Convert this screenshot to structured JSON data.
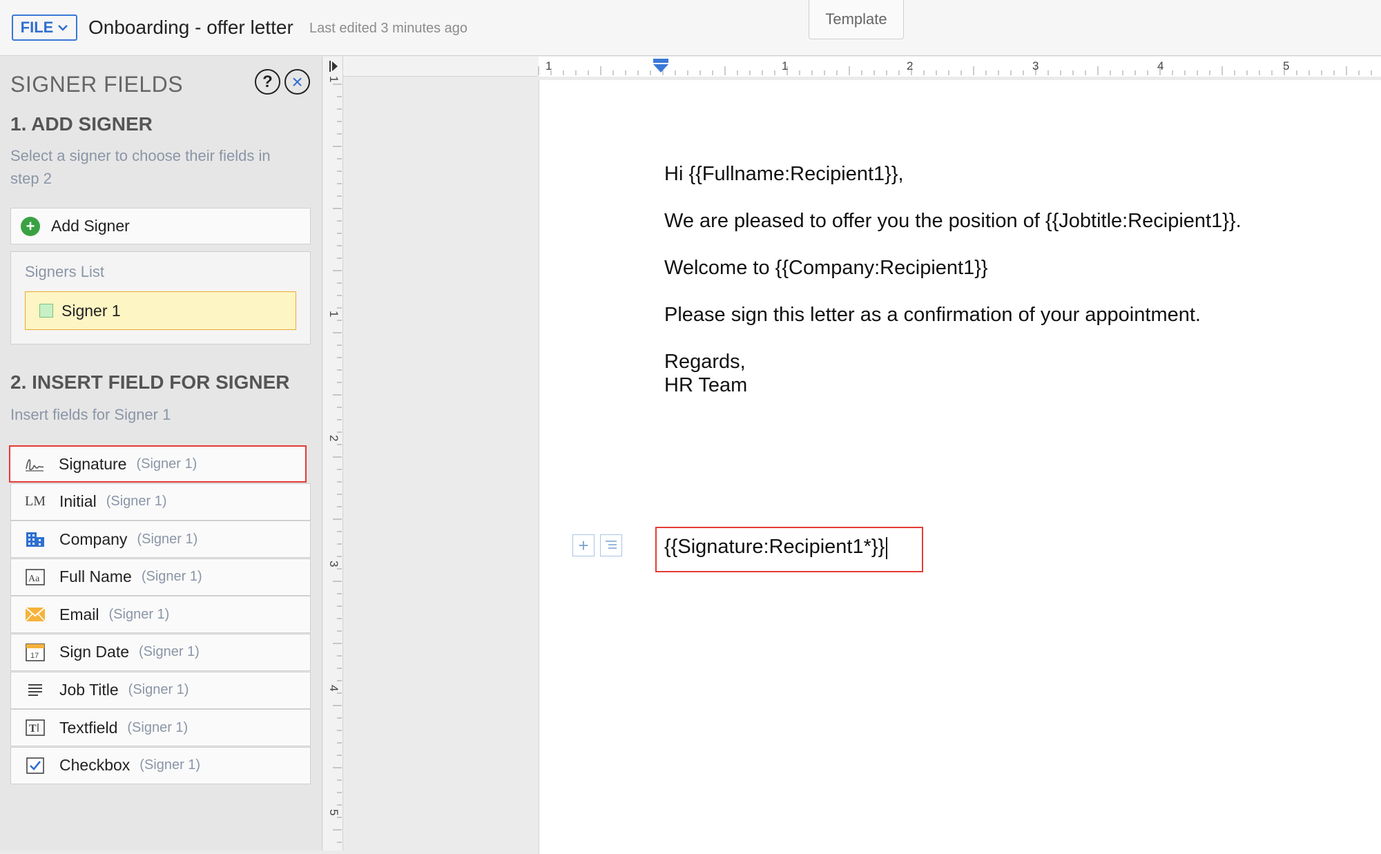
{
  "header": {
    "file_label": "FILE",
    "doc_title": "Onboarding - offer letter",
    "last_edited": "Last edited 3 minutes ago",
    "template_tab": "Template"
  },
  "sidebar": {
    "title": "SIGNER FIELDS",
    "help_label": "?",
    "close_label": "×",
    "step1": {
      "title": "1. ADD SIGNER",
      "description_line1": "Select a signer to choose their fields in",
      "description_line2": "step 2",
      "add_signer_label": "Add Signer",
      "signers_list_label": "Signers List",
      "signers": [
        {
          "label": "Signer 1"
        }
      ]
    },
    "step2": {
      "title": "2. INSERT FIELD FOR SIGNER",
      "description": "Insert fields for Signer 1",
      "fields": [
        {
          "label": "Signature",
          "sub": "(Signer 1)",
          "icon": "signature-icon"
        },
        {
          "label": "Initial",
          "sub": "(Signer 1)",
          "icon": "initial-icon"
        },
        {
          "label": "Company",
          "sub": "(Signer 1)",
          "icon": "company-icon"
        },
        {
          "label": "Full Name",
          "sub": "(Signer 1)",
          "icon": "fullname-icon"
        },
        {
          "label": "Email",
          "sub": "(Signer 1)",
          "icon": "email-icon"
        },
        {
          "label": "Sign Date",
          "sub": "(Signer 1)",
          "icon": "calendar-icon"
        },
        {
          "label": "Job Title",
          "sub": "(Signer 1)",
          "icon": "lines-icon"
        },
        {
          "label": "Textfield",
          "sub": "(Signer 1)",
          "icon": "textfield-icon"
        },
        {
          "label": "Checkbox",
          "sub": "(Signer 1)",
          "icon": "checkbox-icon"
        }
      ]
    }
  },
  "ruler": {
    "h_labels": [
      "1",
      "1",
      "2",
      "3",
      "4",
      "5"
    ],
    "v_labels": [
      "1",
      "1",
      "2",
      "3",
      "4",
      "5"
    ]
  },
  "document": {
    "greeting": "Hi {{Fullname:Recipient1}},",
    "para1": "We are pleased to offer you the position of {{Jobtitle:Recipient1}}.",
    "para2": "Welcome to {{Company:Recipient1}}",
    "para3": "Please sign this letter as a confirmation of your appointment.",
    "closing": "Regards,",
    "team": "HR Team",
    "signature_field": "{{Signature:Recipient1*}}"
  },
  "colors": {
    "accent": "#2f6fd0",
    "selection": "#e53b35",
    "signer_highlight": "#fdf5c3"
  }
}
